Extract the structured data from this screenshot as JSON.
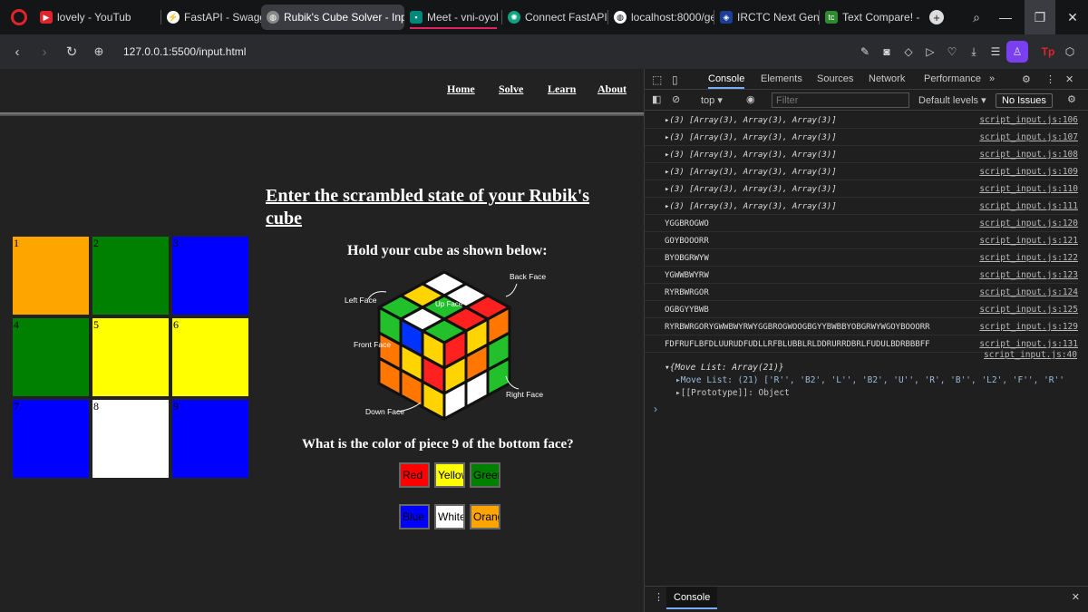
{
  "browser": {
    "tabs": [
      {
        "label": "lovely - YouTub",
        "icon": "youtube-icon",
        "color": "#e0242b"
      },
      {
        "label": "FastAPI - Swagger U",
        "icon": "fastapi-icon",
        "color": "#ffffff"
      },
      {
        "label": "Rubik's Cube Solver - Inpu",
        "icon": "globe-icon",
        "color": "#ffffff",
        "active": true
      },
      {
        "label": "Meet - vni-oyol",
        "icon": "meet-icon",
        "color": "#00897b"
      },
      {
        "label": "Connect FastAPI wi",
        "icon": "chatgpt-icon",
        "color": "#10a37f"
      },
      {
        "label": "localhost:8000/get-",
        "icon": "globe-icon",
        "color": "#ffffff"
      },
      {
        "label": "IRCTC Next Genera",
        "icon": "irctc-icon",
        "color": "#1c3f95"
      },
      {
        "label": "Text Compare! - An",
        "icon": "tc-icon",
        "color": "#2e8b2e"
      }
    ],
    "url": "127.0.0.1:5500/input.html"
  },
  "page": {
    "nav": [
      "Home",
      "Solve",
      "Learn",
      "About"
    ],
    "title": "Enter the scrambled state of your Rubik's cube",
    "hold_text": "Hold your cube as shown below:",
    "question": "What is the color of piece 9 of the bottom face?",
    "face_labels": {
      "back": "Back Face",
      "left": "Left Face",
      "up": "Up Face",
      "front": "Front Face",
      "right": "Right Face",
      "down": "Down Face"
    },
    "grid": [
      {
        "n": "1",
        "color": "#ffa500"
      },
      {
        "n": "2",
        "color": "#008000"
      },
      {
        "n": "3",
        "color": "#0000ff"
      },
      {
        "n": "4",
        "color": "#008000"
      },
      {
        "n": "5",
        "color": "#ffff00"
      },
      {
        "n": "6",
        "color": "#ffff00"
      },
      {
        "n": "7",
        "color": "#0000ff"
      },
      {
        "n": "8",
        "color": "#ffffff"
      },
      {
        "n": "9",
        "color": "#0000ff"
      }
    ],
    "color_buttons": [
      {
        "label": "Red",
        "color": "#ff0000"
      },
      {
        "label": "Yellow",
        "color": "#ffff00"
      },
      {
        "label": "Green",
        "color": "#008000"
      },
      {
        "label": "Blue",
        "color": "#0000ff"
      },
      {
        "label": "White",
        "color": "#ffffff"
      },
      {
        "label": "Orange",
        "color": "#ffa500"
      }
    ]
  },
  "devtools": {
    "tabs": [
      "Console",
      "Elements",
      "Sources",
      "Network",
      "Performance"
    ],
    "context": "top",
    "filter_placeholder": "Filter",
    "levels": "Default levels",
    "issues": "No Issues",
    "logs": [
      {
        "msg": "▸(3) [Array(3), Array(3), Array(3)]",
        "src": "script_input.js:106",
        "italic": true
      },
      {
        "msg": "▸(3) [Array(3), Array(3), Array(3)]",
        "src": "script_input.js:107",
        "italic": true
      },
      {
        "msg": "▸(3) [Array(3), Array(3), Array(3)]",
        "src": "script_input.js:108",
        "italic": true
      },
      {
        "msg": "▸(3) [Array(3), Array(3), Array(3)]",
        "src": "script_input.js:109",
        "italic": true
      },
      {
        "msg": "▸(3) [Array(3), Array(3), Array(3)]",
        "src": "script_input.js:110",
        "italic": true
      },
      {
        "msg": "▸(3) [Array(3), Array(3), Array(3)]",
        "src": "script_input.js:111",
        "italic": true
      },
      {
        "msg": "YGGBROGWO",
        "src": "script_input.js:120",
        "indent": 0
      },
      {
        "msg": "GOYBOOORR",
        "src": "script_input.js:121",
        "indent": 0
      },
      {
        "msg": "BYOBGRWYW",
        "src": "script_input.js:122",
        "indent": 0
      },
      {
        "msg": "YGWWBWYRW",
        "src": "script_input.js:123",
        "indent": 0
      },
      {
        "msg": "RYRBWRGOR",
        "src": "script_input.js:124",
        "indent": 0
      },
      {
        "msg": "OGBGYYBWB",
        "src": "script_input.js:125",
        "indent": 0
      },
      {
        "msg": "RYRBWRGORYGWWBWYRWYGGBROGWOOGBGYYBWBBYOBGRWYWGOYBOOORR",
        "src": "script_input.js:129",
        "indent": 0
      },
      {
        "msg": "FDFRUFLBFDLUURUDFUDLLRFBLUBBLRLDDRURRDBRLFUDULBDRBBBFF",
        "src": "script_input.js:131",
        "indent": 0
      }
    ],
    "last_src": "script_input.js:40",
    "movelist_head": "▾{Move List: Array(21)}",
    "movelist_line": "▸Move List: (21) ['R'', 'B2', 'L'', 'B2', 'U'', 'R', 'B'', 'L2', 'F'', 'R''",
    "prototype_line": "▸[[Prototype]]: Object",
    "prompt": "›",
    "drawer_tab": "Console"
  }
}
